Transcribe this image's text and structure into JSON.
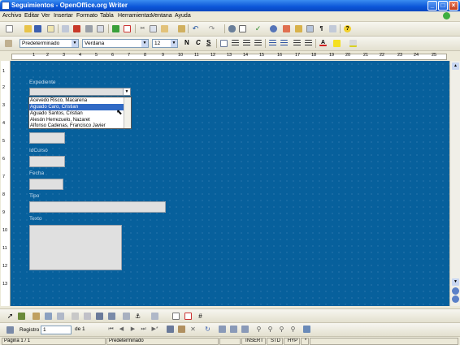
{
  "window": {
    "title": "Seguimientos - OpenOffice.org Writer",
    "minimize": "_",
    "maximize": "□",
    "close": "×"
  },
  "menu": [
    "Archivo",
    "Editar",
    "Ver",
    "Insertar",
    "Formato",
    "Tabla",
    "Herramientas",
    "Ventana",
    "Ayuda"
  ],
  "format_toolbar": {
    "style": "Predeterminado",
    "font": "Verdana",
    "size": "12",
    "bold": "N",
    "italic": "C",
    "underline": "S"
  },
  "ruler": {
    "labels": [
      "1",
      "2",
      "3",
      "4",
      "5",
      "6",
      "7",
      "8",
      "9",
      "10",
      "11",
      "12",
      "13",
      "14",
      "15",
      "16",
      "17",
      "18",
      "19",
      "20",
      "21",
      "22",
      "23",
      "24",
      "25"
    ]
  },
  "vruler": {
    "labels": [
      "1",
      "2",
      "3",
      "4",
      "5",
      "6",
      "7",
      "8",
      "9",
      "10",
      "11",
      "12",
      "13"
    ]
  },
  "form": {
    "expediente_label": "Expediente",
    "dropdown_items": [
      "Acevedo Risco, Macarena",
      "Aguado Caro, Cristian",
      "Aguado Santos, Cristian",
      "Alesón Herrezuelo, Nazaret",
      "Alfonso Cadenas, Francisco Javier"
    ],
    "highlighted_index": 1,
    "idcurso_label": "IdCurso",
    "fecha_label": "Fecha",
    "tipo_label": "Tipo",
    "texto_label": "Texto"
  },
  "navbar": {
    "registro_label": "Registro",
    "registro_value": "1",
    "de_label": "de 1"
  },
  "status": {
    "page": "Página 1 / 1",
    "style": "Predeterminado",
    "insert": "INSERT",
    "std": "STD",
    "hyp": "HYP",
    "star": "*"
  },
  "colors": {
    "document_bg": "#07609c",
    "highlight": "#316ac5",
    "titlebar": "#0b55d8"
  }
}
